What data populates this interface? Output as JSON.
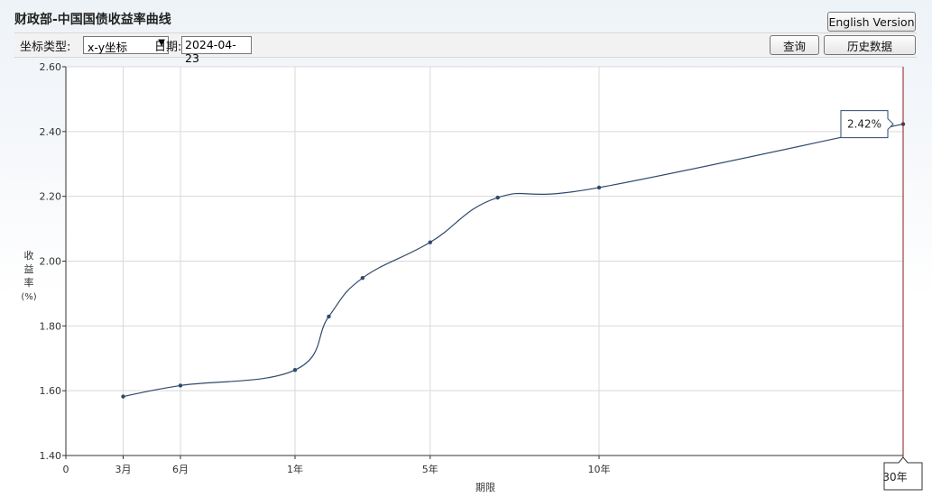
{
  "header": {
    "title": "财政部-中国国债收益率曲线",
    "english_label": "English Version"
  },
  "toolbar": {
    "coord_type_label": "坐标类型:",
    "coord_type_value": "x-y坐标",
    "date_label": "日期:",
    "date_value": "2024-04-23",
    "query_label": "查询",
    "history_label": "历史数据"
  },
  "chart_data": {
    "type": "line",
    "ylabel": "收益率(%)",
    "ylabel_chars": [
      "收",
      "益",
      "率",
      "(%)"
    ],
    "xlabel": "期限",
    "ylim": [
      1.4,
      2.6
    ],
    "yticks": [
      "1.40",
      "1.60",
      "1.80",
      "2.00",
      "2.20",
      "2.40",
      "2.60"
    ],
    "xlim": [
      0,
      30
    ],
    "xticks": [
      {
        "value": 0,
        "label": "0"
      },
      {
        "value": 0.25,
        "label": "3月"
      },
      {
        "value": 0.5,
        "label": "6月"
      },
      {
        "value": 1,
        "label": "1年"
      },
      {
        "value": 5,
        "label": "5年"
      },
      {
        "value": 10,
        "label": "10年"
      },
      {
        "value": 30,
        "label": "30年"
      }
    ],
    "x_scale": "piecewise: 0–1年 spans one unit, 1–10年 linear, 10–30年 compressed",
    "grid": true,
    "series": [
      {
        "x": [
          0.25,
          0.5,
          1,
          2,
          3,
          5,
          7,
          10,
          30
        ],
        "values": [
          1.582,
          1.616,
          1.664,
          1.829,
          1.948,
          2.058,
          2.196,
          2.227,
          2.423
        ]
      }
    ],
    "tooltip": "2.42%",
    "crosshair_label": "30年",
    "line_color": "#2e4a6b",
    "crosshair_color": "#8b1a1a"
  }
}
